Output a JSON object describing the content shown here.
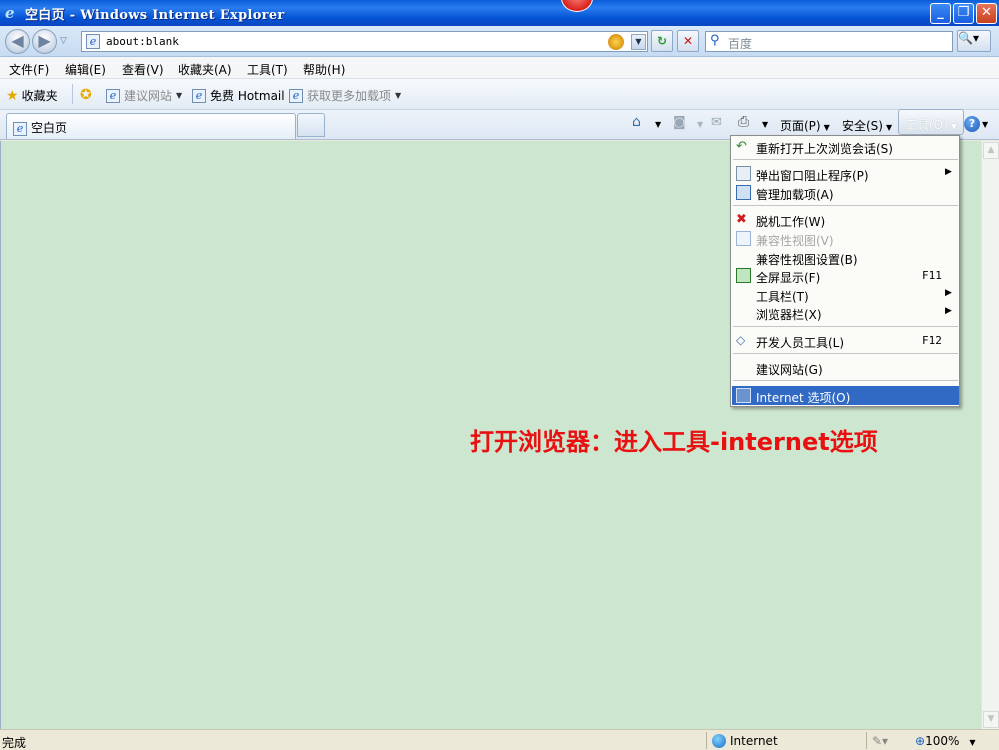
{
  "window": {
    "title": "空白页 - Windows Internet Explorer",
    "minimize": "_",
    "maximize": "❐",
    "close": "✕"
  },
  "addressbar": {
    "back": "◀",
    "forward": "▶",
    "url": "about:blank",
    "refresh": "↻",
    "stop": "✕",
    "search_placeholder": "百度",
    "search_button": "🔍▾"
  },
  "menubar": [
    "文件(F)",
    "编辑(E)",
    "查看(V)",
    "收藏夹(A)",
    "工具(T)",
    "帮助(H)"
  ],
  "favorites_bar": {
    "favorites_label": "收藏夹",
    "suggested_sites": "建议网站",
    "hotmail": "免费 Hotmail",
    "more_addons": "获取更多加载项"
  },
  "tab": {
    "title": "空白页"
  },
  "command_bar": {
    "page": "页面(P)",
    "safety": "安全(S)",
    "tools": "工具(O)",
    "help": "?"
  },
  "tools_menu": {
    "items": [
      {
        "label": "重新打开上次浏览会话(S)",
        "shortcut": "",
        "submenu": false,
        "disabled": false
      },
      {
        "label": "弹出窗口阻止程序(P)",
        "shortcut": "",
        "submenu": true,
        "disabled": false
      },
      {
        "label": "管理加载项(A)",
        "shortcut": "",
        "submenu": false,
        "disabled": false
      },
      {
        "label": "脱机工作(W)",
        "shortcut": "",
        "submenu": false,
        "disabled": false
      },
      {
        "label": "兼容性视图(V)",
        "shortcut": "",
        "submenu": false,
        "disabled": true
      },
      {
        "label": "兼容性视图设置(B)",
        "shortcut": "",
        "submenu": false,
        "disabled": false
      },
      {
        "label": "全屏显示(F)",
        "shortcut": "F11",
        "submenu": false,
        "disabled": false
      },
      {
        "label": "工具栏(T)",
        "shortcut": "",
        "submenu": true,
        "disabled": false
      },
      {
        "label": "浏览器栏(X)",
        "shortcut": "",
        "submenu": true,
        "disabled": false
      },
      {
        "label": "开发人员工具(L)",
        "shortcut": "F12",
        "submenu": false,
        "disabled": false
      },
      {
        "label": "建议网站(G)",
        "shortcut": "",
        "submenu": false,
        "disabled": false
      },
      {
        "label": "Internet 选项(O)",
        "shortcut": "",
        "submenu": false,
        "disabled": false,
        "selected": true
      }
    ]
  },
  "annotation": "打开浏览器：进入工具-internet选项",
  "statusbar": {
    "status": "完成",
    "zone": "Internet",
    "zoom": "100%"
  },
  "colors": {
    "content_bg": "#cde6cf",
    "annotation": "#e81010",
    "menu_highlight": "#316ac5"
  }
}
